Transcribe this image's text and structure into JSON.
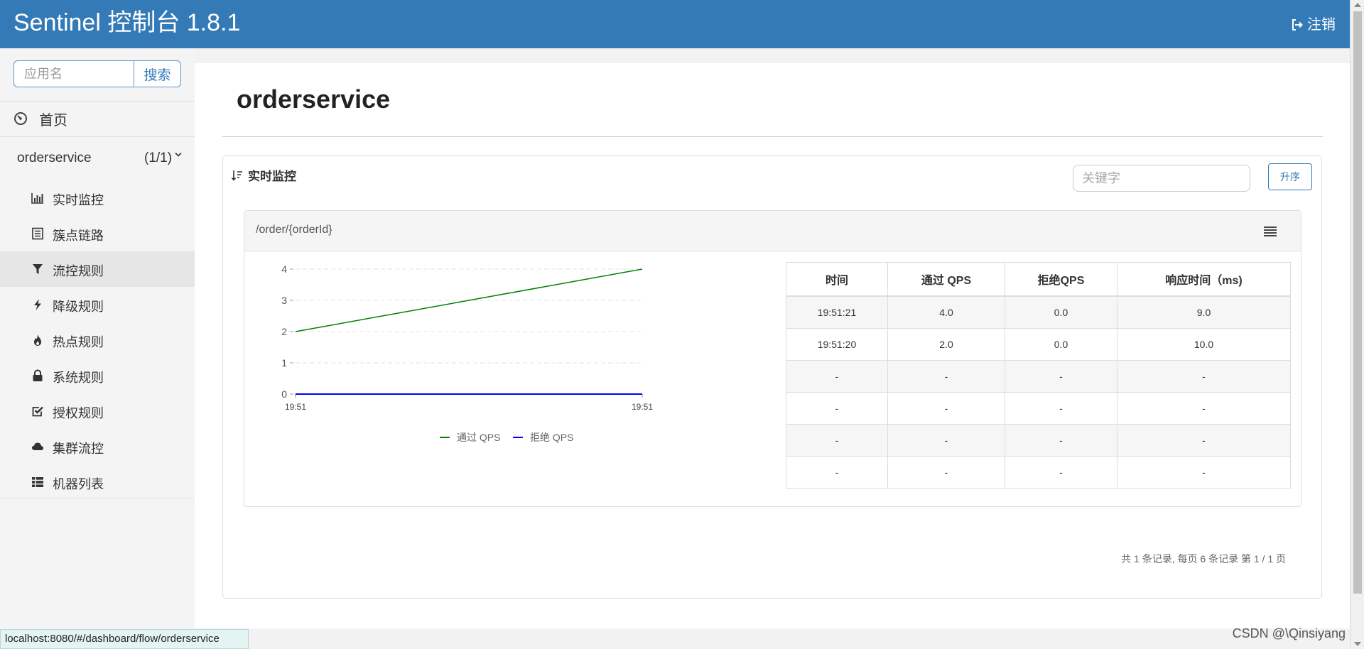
{
  "header": {
    "brand": "Sentinel 控制台 1.8.1",
    "logout_label": "注销"
  },
  "sidebar": {
    "search_placeholder": "应用名",
    "search_button": "搜索",
    "home_label": "首页",
    "app": {
      "name": "orderservice",
      "count": "(1/1)"
    },
    "menu": [
      {
        "label": "实时监控",
        "icon": "bar-chart-icon",
        "active": false
      },
      {
        "label": "簇点链路",
        "icon": "list-alt-icon",
        "active": false
      },
      {
        "label": "流控规则",
        "icon": "filter-icon",
        "active": true
      },
      {
        "label": "降级规则",
        "icon": "flash-icon",
        "active": false
      },
      {
        "label": "热点规则",
        "icon": "fire-icon",
        "active": false
      },
      {
        "label": "系统规则",
        "icon": "lock-icon",
        "active": false
      },
      {
        "label": "授权规则",
        "icon": "check-icon",
        "active": false
      },
      {
        "label": "集群流控",
        "icon": "cloud-icon",
        "active": false
      },
      {
        "label": "机器列表",
        "icon": "th-list-icon",
        "active": false
      }
    ]
  },
  "main": {
    "title": "orderservice",
    "panel_title": "实时监控",
    "keyword_placeholder": "关键字",
    "sort_button": "升序",
    "resource": "/order/{orderId}",
    "table": {
      "headers": [
        "时间",
        "通过 QPS",
        "拒绝QPS",
        "响应时间（ms)"
      ],
      "rows": [
        [
          "19:51:21",
          "4.0",
          "0.0",
          "9.0"
        ],
        [
          "19:51:20",
          "2.0",
          "0.0",
          "10.0"
        ],
        [
          "-",
          "-",
          "-",
          "-"
        ],
        [
          "-",
          "-",
          "-",
          "-"
        ],
        [
          "-",
          "-",
          "-",
          "-"
        ],
        [
          "-",
          "-",
          "-",
          "-"
        ]
      ]
    },
    "pagination": "共 1 条记录, 每页 6 条记录 第 1 / 1 页"
  },
  "chart_data": {
    "type": "line",
    "x": [
      "19:51",
      "19:51"
    ],
    "series": [
      {
        "name": "通过 QPS",
        "values": [
          2,
          4
        ],
        "color": "#008000"
      },
      {
        "name": "拒绝 QPS",
        "values": [
          0,
          0
        ],
        "color": "#0000ff"
      }
    ],
    "yticks": [
      0,
      1,
      2,
      3,
      4
    ],
    "ylim": [
      0,
      4
    ],
    "grid": true,
    "legend": "bottom"
  },
  "status_url": "localhost:8080/#/dashboard/flow/orderservice",
  "watermark": "CSDN @\\Qinsiyang"
}
